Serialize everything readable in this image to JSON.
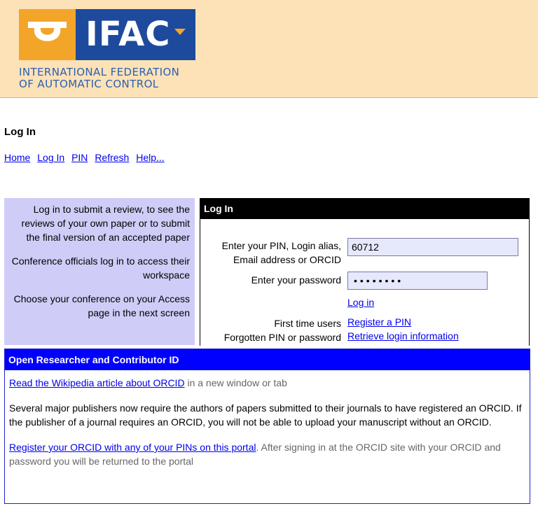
{
  "header": {
    "logo_text": "IFAC",
    "org_line1": "INTERNATIONAL FEDERATION",
    "org_line2": "OF AUTOMATIC CONTROL"
  },
  "page_title": "Log In",
  "nav": [
    "Home",
    "Log In",
    "PIN",
    "Refresh",
    "Help..."
  ],
  "info_panel": {
    "p1": "Log in to submit a review, to see the reviews of your own paper or to submit the final version of an accepted paper",
    "p2": "Conference officials log in to access their workspace",
    "p3": "Choose your conference on your Access page in the next screen"
  },
  "login": {
    "header": "Log In",
    "pin_label_line1": "Enter your PIN, Login alias,",
    "pin_label_line2": "Email address or ORCID",
    "pin_value": "60712",
    "password_label": "Enter your password",
    "password_mask": "••••••••",
    "login_link": "Log in",
    "first_time_label": "First time users",
    "register_link": "Register a PIN",
    "forgotten_label": "Forgotten PIN or password",
    "retrieve_link": "Retrieve login information"
  },
  "orcid": {
    "header": "Open Researcher and Contributor ID",
    "wiki_link": "Read the Wikipedia article about ORCID",
    "wiki_suffix": " in a new window or tab",
    "para": "Several major publishers now require the authors of papers submitted to their journals to have registered an ORCID. If the publisher of a journal requires an ORCID, you will not be able to upload your manuscript without an ORCID.",
    "register_link": "Register your ORCID with any of your PINs on this portal",
    "register_suffix": ". After signing in at the ORCID site with your ORCID and password you will be returned to the portal"
  },
  "colors": {
    "header_bg": "#fde2b8",
    "info_panel_bg": "#cfcdf7",
    "orcid_header_bg": "#0000ff",
    "logo_orange": "#f3a52a",
    "logo_blue": "#1d4a9c"
  }
}
